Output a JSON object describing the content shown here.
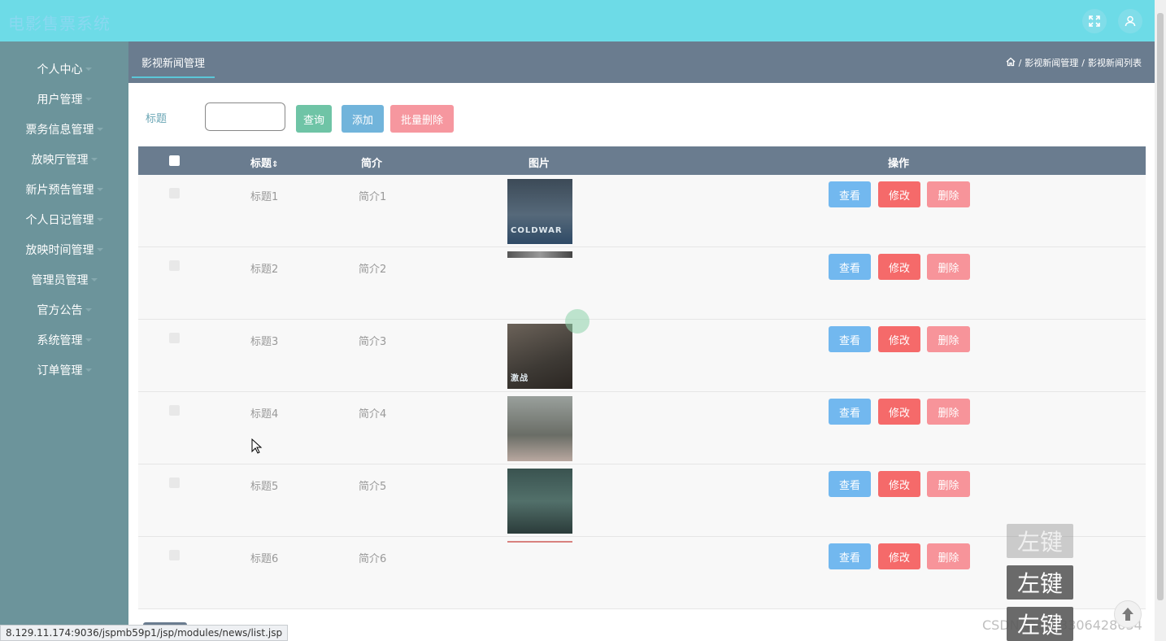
{
  "app": {
    "title": "电影售票系统"
  },
  "sidebar": {
    "items": [
      {
        "label": "个人中心"
      },
      {
        "label": "用户管理"
      },
      {
        "label": "票务信息管理"
      },
      {
        "label": "放映厅管理"
      },
      {
        "label": "新片预告管理"
      },
      {
        "label": "个人日记管理"
      },
      {
        "label": "放映时间管理"
      },
      {
        "label": "管理员管理"
      },
      {
        "label": "官方公告"
      },
      {
        "label": "系统管理"
      },
      {
        "label": "订单管理"
      }
    ]
  },
  "header": {
    "title": "影视新闻管理",
    "breadcrumb": [
      "影视新闻管理",
      "影视新闻列表"
    ],
    "separator": "/"
  },
  "search": {
    "label": "标题",
    "value": "",
    "buttons": {
      "query": "查询",
      "add": "添加",
      "batch_delete": "批量删除"
    }
  },
  "table": {
    "columns": [
      "标题",
      "简介",
      "图片",
      "操作"
    ],
    "sort_glyph": "⇕",
    "actions": {
      "view": "查看",
      "edit": "修改",
      "delete": "删除"
    },
    "rows": [
      {
        "title": "标题1",
        "intro": "简介1",
        "poster": "blue-dark",
        "poster_text": "COLDWAR"
      },
      {
        "title": "标题2",
        "intro": "简介2",
        "poster": "grey-strip",
        "poster_text": ""
      },
      {
        "title": "标题3",
        "intro": "简介3",
        "poster": "grey-brown",
        "poster_text": "激战"
      },
      {
        "title": "标题4",
        "intro": "简介4",
        "poster": "light-grey",
        "poster_text": ""
      },
      {
        "title": "标题5",
        "intro": "简介5",
        "poster": "teal-dark",
        "poster_text": ""
      },
      {
        "title": "标题6",
        "intro": "简介6",
        "poster": "red-strip",
        "poster_text": ""
      }
    ]
  },
  "status_bar": {
    "url": "8.129.11.174:9036/jspmb59p1/jsp/modules/news/list.jsp"
  },
  "overlay": {
    "watermark": "CSDN @qq_3306428634",
    "key_badges": [
      "左键",
      "左键",
      "左键"
    ]
  },
  "colors": {
    "topbar": "#6ddbe7",
    "sidebar": "#6c949b",
    "header": "#6a7c8f",
    "btn_query": "#6fc4a6",
    "btn_add": "#71b4db",
    "btn_batch_delete": "#f6979f",
    "btn_view": "#72b8ef",
    "btn_edit": "#f56a6a",
    "btn_delete": "#f7949a"
  }
}
